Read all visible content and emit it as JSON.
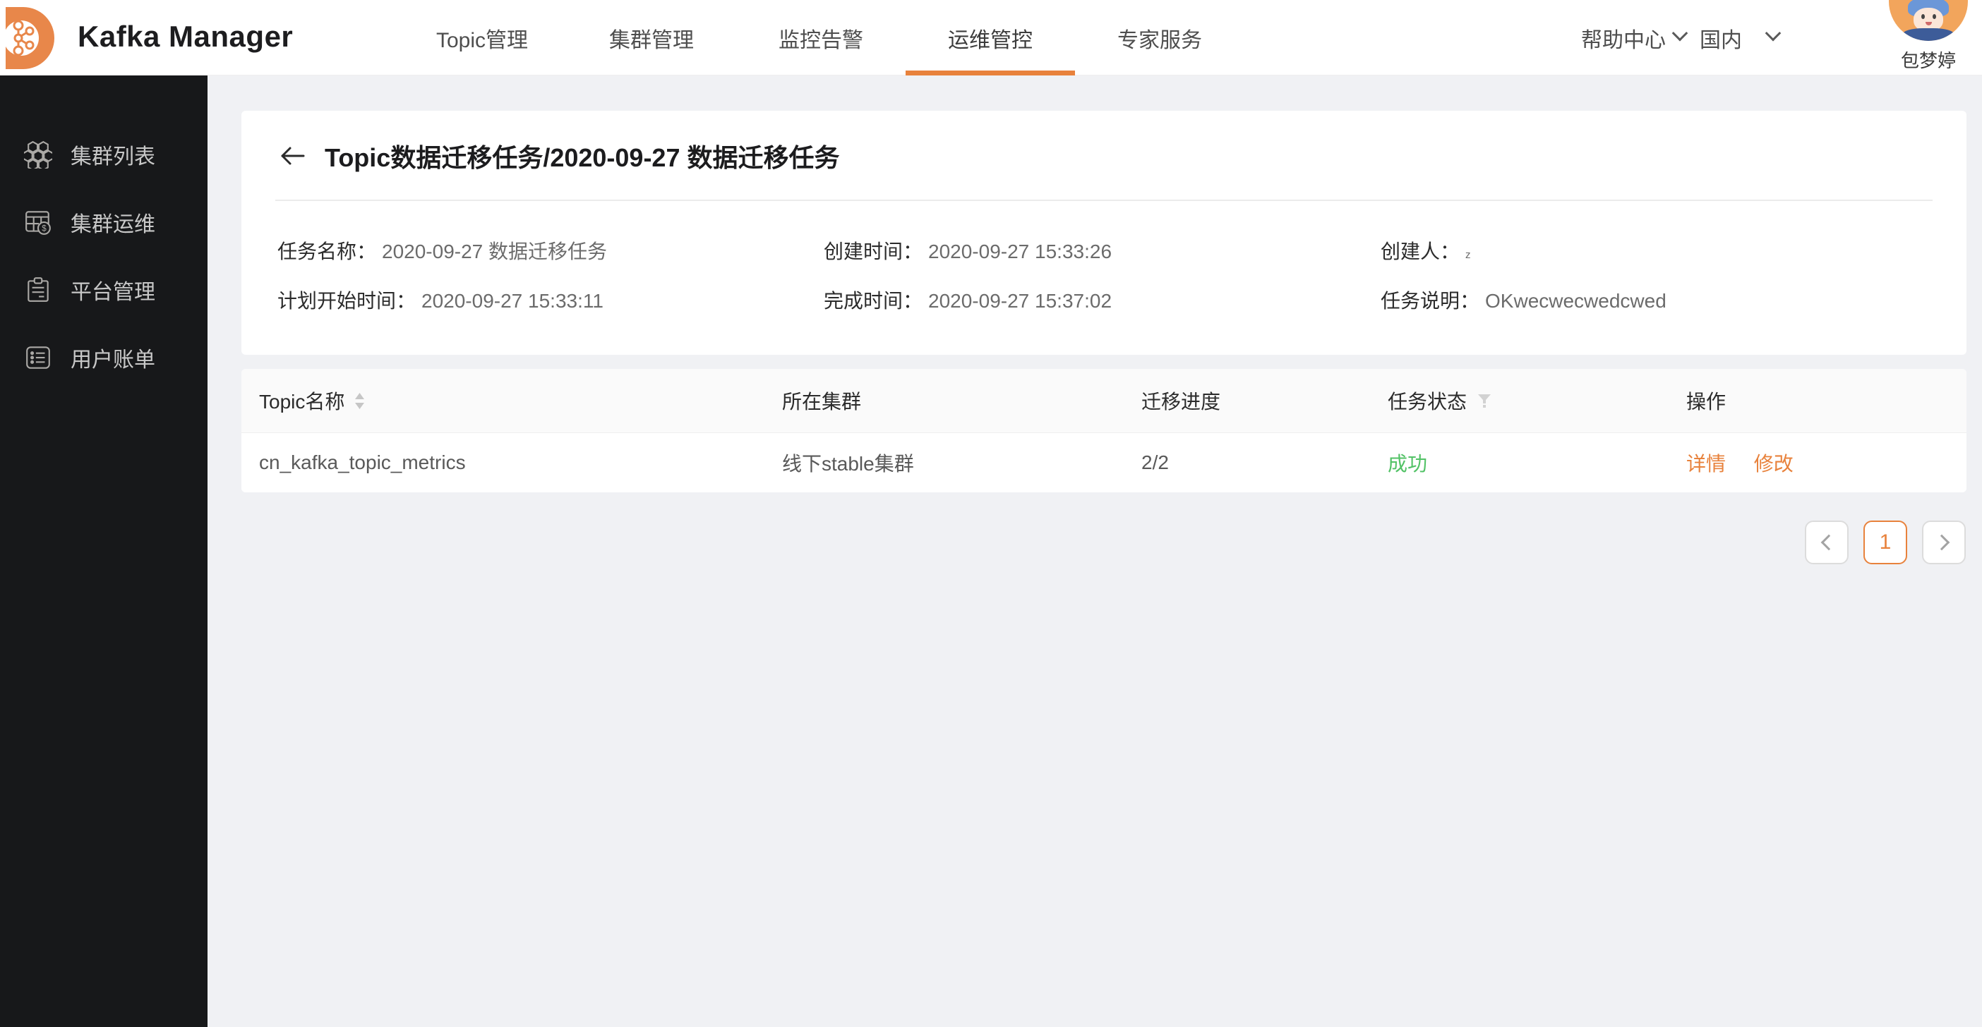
{
  "brand": {
    "title": "Kafka Manager"
  },
  "header": {
    "nav": [
      {
        "label": "Topic管理",
        "active": false
      },
      {
        "label": "集群管理",
        "active": false
      },
      {
        "label": "监控告警",
        "active": false
      },
      {
        "label": "运维管控",
        "active": true
      },
      {
        "label": "专家服务",
        "active": false
      }
    ],
    "help_label": "帮助中心",
    "region_label": "国内",
    "user_name": "包梦婷"
  },
  "sidebar": {
    "items": [
      {
        "label": "集群列表",
        "icon": "honeycomb-cluster-icon"
      },
      {
        "label": "集群运维",
        "icon": "cluster-ops-coin-icon"
      },
      {
        "label": "平台管理",
        "icon": "clipboard-icon"
      },
      {
        "label": "用户账单",
        "icon": "bill-list-icon"
      }
    ]
  },
  "page": {
    "title": "Topic数据迁移任务/2020-09-27 数据迁移任务",
    "details": {
      "task_name_label": "任务名称：",
      "task_name": "2020-09-27 数据迁移任务",
      "create_time_label": "创建时间：",
      "create_time": "2020-09-27 15:33:26",
      "creator_label": "创建人：",
      "creator": "z",
      "plan_start_label": "计划开始时间：",
      "plan_start": "2020-09-27 15:33:11",
      "finish_time_label": "完成时间：",
      "finish_time": "2020-09-27 15:37:02",
      "task_desc_label": "任务说明：",
      "task_desc": "OKwecwecwedcwed"
    }
  },
  "table": {
    "columns": {
      "topic": "Topic名称",
      "cluster": "所在集群",
      "progress": "迁移进度",
      "status": "任务状态",
      "actions": "操作"
    },
    "rows": [
      {
        "topic": "cn_kafka_topic_metrics",
        "cluster": "线下stable集群",
        "progress": "2/2",
        "status": "成功",
        "action_detail": "详情",
        "action_edit": "修改"
      }
    ]
  },
  "pagination": {
    "current": "1"
  },
  "colors": {
    "accent": "#e8823c",
    "success": "#52c266",
    "sidebar_bg": "#17181a",
    "page_bg": "#f0f1f4"
  }
}
